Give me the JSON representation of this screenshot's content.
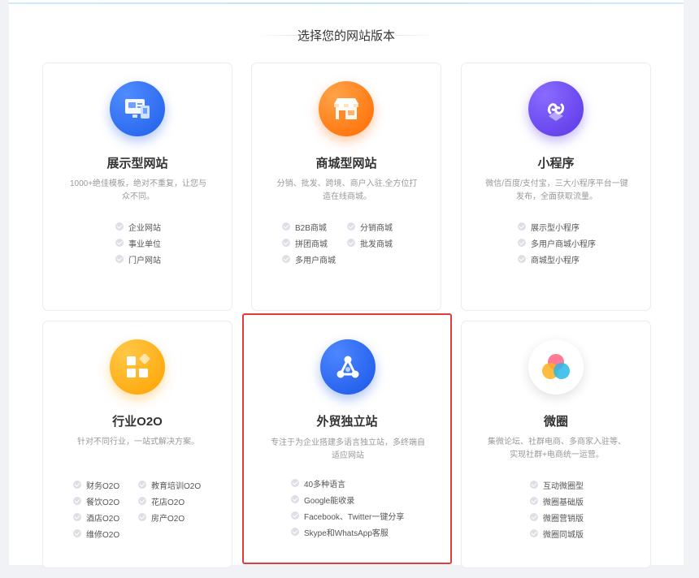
{
  "section": {
    "title": "选择您的网站版本"
  },
  "cards": [
    {
      "title": "展示型网站",
      "desc": "1000+绝佳模板，绝对不重复，让您与众不同。",
      "icon": "display-site-icon",
      "color": "#2a6ff5",
      "features": [
        "企业网站",
        "事业单位",
        "门户网站"
      ]
    },
    {
      "title": "商城型网站",
      "desc": "分销、批发、跨境、商户入驻,全方位打造在线商城。",
      "icon": "storefront-icon",
      "color": "#ff7a12",
      "features": [
        "B2B商城",
        "分销商城",
        "拼团商城",
        "批发商城",
        "多用户商城"
      ]
    },
    {
      "title": "小程序",
      "desc": "微信/百度/支付宝，三大小程序平台一键发布，全面获取流量。",
      "icon": "mini-program-icon",
      "color": "#6a4bf0",
      "features": [
        "展示型小程序",
        "多用户商城小程序",
        "商城型小程序"
      ]
    },
    {
      "title": "行业O2O",
      "desc": "针对不同行业，一站式解决方案。",
      "icon": "grid-diamond-icon",
      "color": "#ffb11a",
      "features": [
        "财务O2O",
        "教育培训O2O",
        "餐饮O2O",
        "花店O2O",
        "酒店O2O",
        "房产O2O",
        "维修O2O"
      ]
    },
    {
      "title": "外贸独立站",
      "desc": "专注于为企业搭建多语言独立站，多终端自适应网站",
      "icon": "network-nodes-icon",
      "color": "#2462f0",
      "features": [
        "40多种语言",
        "Google能收录",
        "Facebook、Twitter一键分享",
        "Skype和WhatsApp客服"
      ]
    },
    {
      "title": "微圈",
      "desc": "集微论坛、社群电商、多商家入驻等、实现社群+电商统一运营。",
      "icon": "overlapping-circles-icon",
      "color": "#ffffff",
      "features": [
        "互动微圈型",
        "微圈基础版",
        "微圈营销版",
        "微圈同城版"
      ]
    }
  ]
}
